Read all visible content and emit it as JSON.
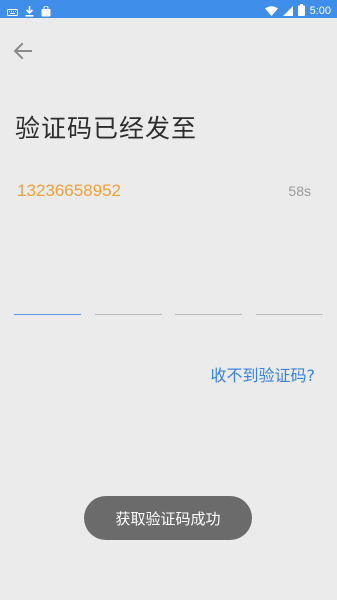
{
  "status_bar": {
    "time": "5:00",
    "icons": [
      "keyboard-icon",
      "download-icon",
      "shopping-bag-icon",
      "wifi-icon",
      "signal-icon",
      "battery-icon"
    ]
  },
  "header": {
    "back_icon": "arrow-left-icon",
    "title": "验证码已经发至"
  },
  "verification": {
    "phone_number": "13236658952",
    "countdown": "58s",
    "code_digits": [
      "",
      "",
      "",
      ""
    ],
    "resend_link": "收不到验证码?"
  },
  "toast": {
    "message": "获取验证码成功"
  },
  "colors": {
    "status_bar": "#3f8ee9",
    "background": "#ebebeb",
    "phone_accent": "#f2a13a",
    "link": "#3a83e4",
    "active_underline": "#5d99ec",
    "toast_bg": "#6b6b6b"
  }
}
